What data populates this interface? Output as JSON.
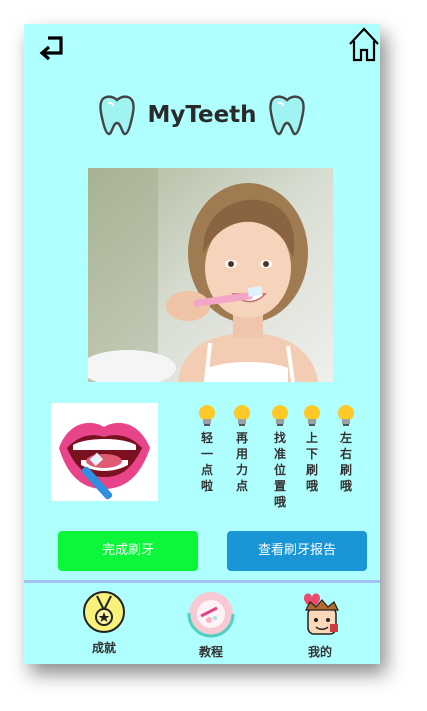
{
  "app": {
    "title": "MyTeeth"
  },
  "nav": {
    "back_icon": "return-arrow-icon",
    "home_icon": "home-icon"
  },
  "hero": {
    "description_icon": "girl-brushing-teeth-photo"
  },
  "mouth": {
    "icon": "open-mouth-toothbrush-illustration"
  },
  "tips": [
    {
      "icon": "lightbulb-icon",
      "text": "轻一点啦"
    },
    {
      "icon": "lightbulb-icon",
      "text": "再用力点"
    },
    {
      "icon": "lightbulb-icon",
      "text": "找准位置哦"
    },
    {
      "icon": "lightbulb-icon",
      "text": "上下刷哦"
    },
    {
      "icon": "lightbulb-icon",
      "text": "左右刷哦"
    }
  ],
  "actions": {
    "done_label": "完成刷牙",
    "report_label": "查看刷牙报告"
  },
  "tabs": [
    {
      "label": "成就",
      "icon": "medal-icon"
    },
    {
      "label": "教程",
      "icon": "tutorial-icon"
    },
    {
      "label": "我的",
      "icon": "profile-avatar-icon"
    }
  ],
  "colors": {
    "background": "#b0ffff",
    "done_button": "#0cf73a",
    "report_button": "#1a96d6",
    "divider": "#a4c2f0"
  }
}
